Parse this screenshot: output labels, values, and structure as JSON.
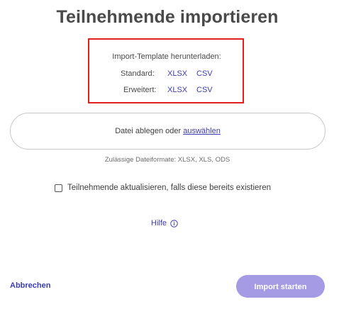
{
  "title": "Teilnehmende importieren",
  "template": {
    "heading": "Import-Template herunterladen:",
    "standard_label": "Standard:",
    "extended_label": "Erweitert:",
    "xlsx_label": "XLSX",
    "csv_label": "CSV"
  },
  "dropzone": {
    "text": "Datei ablegen oder",
    "browse_link": "auswählen"
  },
  "formats_note": "Zulässige Dateiformate: XLSX, XLS, ODS",
  "update_checkbox": {
    "label": "Teilnehmende aktualisieren, falls diese bereits existieren",
    "checked": false
  },
  "help_link": "Hilfe",
  "footer": {
    "cancel_label": "Abbrechen",
    "start_label": "Import starten",
    "start_disabled": true
  },
  "colors": {
    "accent": "#3b3bb4",
    "highlight_border": "#e0201c",
    "disabled_button": "#a49be4"
  },
  "icons": {
    "help": "info-circle-icon"
  }
}
